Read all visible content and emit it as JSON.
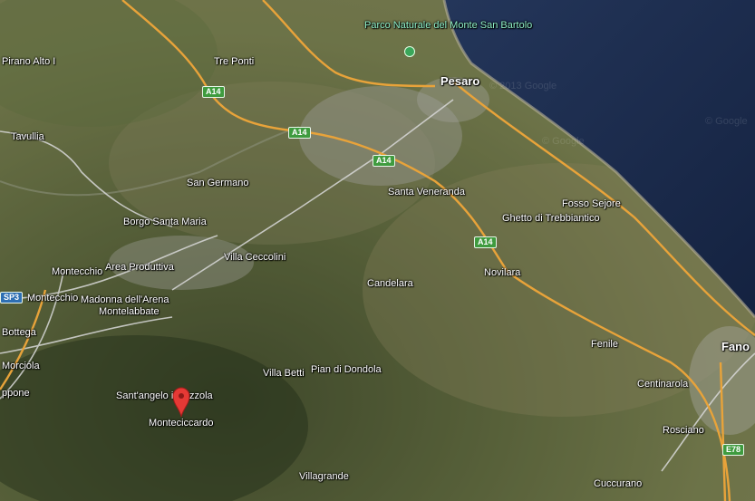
{
  "map": {
    "places": {
      "parco": "Parco Naturale del Monte San Bartolo",
      "pirano": "Pirano Alto I",
      "tre_ponti": "Tre Ponti",
      "pesaro": "Pesaro",
      "tavullia": "Tavullia",
      "san_germano": "San Germano",
      "santa_veneranda": "Santa Veneranda",
      "fosso_sejore": "Fosso Sejore",
      "ghetto": "Ghetto di Trebbiantico",
      "borgo": "Borgo Santa Maria",
      "montecchio_1": "Montecchio",
      "area_produttiva": "Area Produttiva",
      "villa_ceccolini": "Villa Ceccolini",
      "novilara": "Novilara",
      "montecchio_2": "Montecchio",
      "madonna": "Madonna dell'Arena",
      "candelara": "Candelara",
      "montelabbate": "Montelabbate",
      "bottega": "Bottega",
      "fenile": "Fenile",
      "fano": "Fano",
      "morciola": "Morciola",
      "villa_betti": "Villa Betti",
      "pian_di_dondola": "Pian di Dondola",
      "centinarola": "Centinarola",
      "santangelo": "Sant'angelo in Lizzola",
      "appone": "ppone",
      "monteciccardo": "Monteciccardo",
      "rosciano": "Rosciano",
      "villagrande": "Villagrande",
      "cuccurano": "Cuccurano"
    },
    "shields": {
      "a14_1": "A14",
      "a14_2": "A14",
      "a14_3": "A14",
      "a14_4": "A14",
      "sp3": "SP3",
      "e78": "E78"
    },
    "watermarks": {
      "w1": "© 2013 Google",
      "w2": "© Google",
      "w3": "© Google"
    },
    "marker": {
      "icon": "map-pin-icon",
      "color": "#e53935"
    },
    "colors": {
      "sea": "#1b2b4a",
      "highway": "#e8a33a",
      "road": "#c9c9c9"
    }
  }
}
